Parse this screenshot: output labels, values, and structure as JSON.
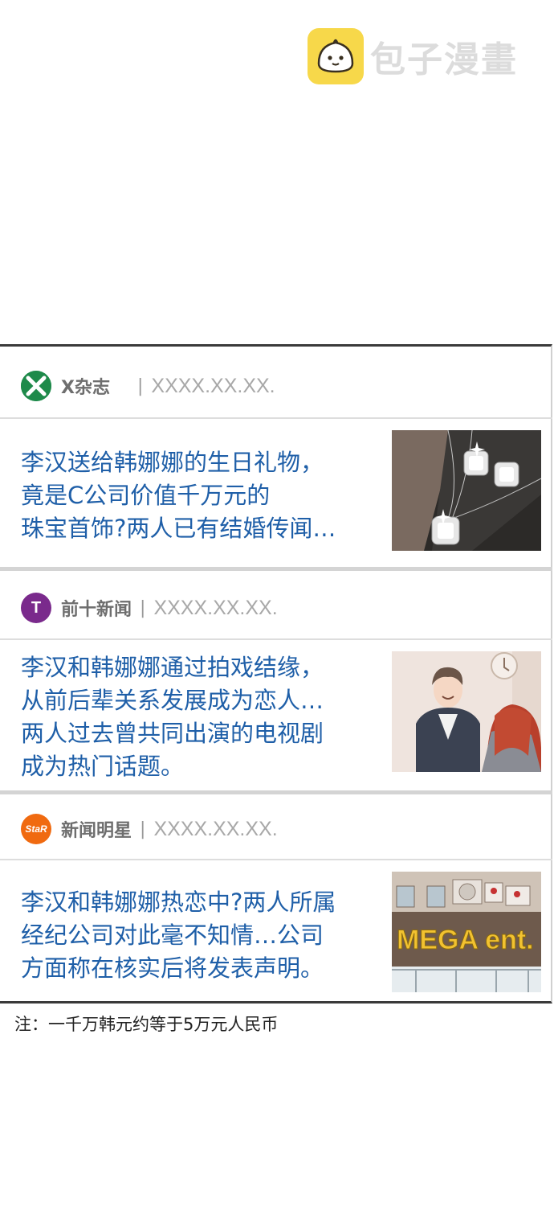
{
  "watermark": {
    "brand": "包子漫畫"
  },
  "articles": [
    {
      "source": "X杂志",
      "logo_letter": "X",
      "logo_color": "#1e8a4a",
      "date": "XXXX.XX.XX.",
      "headline_lines": [
        "李汉送给韩娜娜的生日礼物，",
        "竟是C公司价值千万元的",
        "珠宝首饰?两人已有结婚传闻…"
      ],
      "image": "jewelry-necklace-earrings"
    },
    {
      "source": "前十新闻",
      "logo_letter": "T",
      "logo_color": "#7a2a8c",
      "date": "XXXX.XX.XX.",
      "headline_lines": [
        "李汉和韩娜娜通过拍戏结缘，",
        "从前后辈关系发展成为恋人…",
        "两人过去曾共同出演的电视剧",
        "成为热门话题。"
      ],
      "image": "couple-illustration"
    },
    {
      "source": "新闻明星",
      "logo_letter": "StaR",
      "logo_color": "#f06a10",
      "date": "XXXX.XX.XX.",
      "headline_lines": [
        "李汉和韩娜娜热恋中?两人所属",
        "经纪公司对此毫不知情…公司",
        "方面称在核实后将发表声明。"
      ],
      "image": "mega-ent-building",
      "image_sign": "MEGA ent."
    }
  ],
  "note": "注：一千万韩元约等于5万元人民币"
}
